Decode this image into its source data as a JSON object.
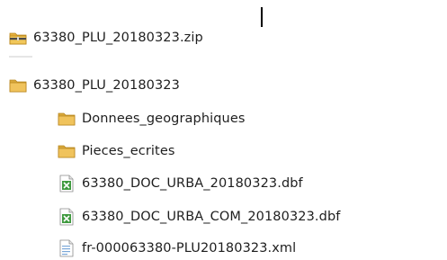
{
  "explorer": {
    "archive": {
      "name": "63380_PLU_20180323.zip",
      "icon": "zip-folder-icon"
    },
    "root_folder": {
      "name": "63380_PLU_20180323",
      "icon": "folder-icon"
    },
    "children": [
      {
        "name": "Donnees_geographiques",
        "icon": "folder-icon"
      },
      {
        "name": "Pieces_ecrites",
        "icon": "folder-icon"
      },
      {
        "name": "63380_DOC_URBA_20180323.dbf",
        "icon": "spreadsheet-file-icon"
      },
      {
        "name": "63380_DOC_URBA_COM_20180323.dbf",
        "icon": "spreadsheet-file-icon"
      },
      {
        "name": "fr-000063380-PLU20180323.xml",
        "icon": "xml-file-icon"
      }
    ]
  },
  "colors": {
    "folder": "#e8b94a",
    "spreadsheet": "#3f9a3f",
    "text": "#1e1e1e"
  }
}
